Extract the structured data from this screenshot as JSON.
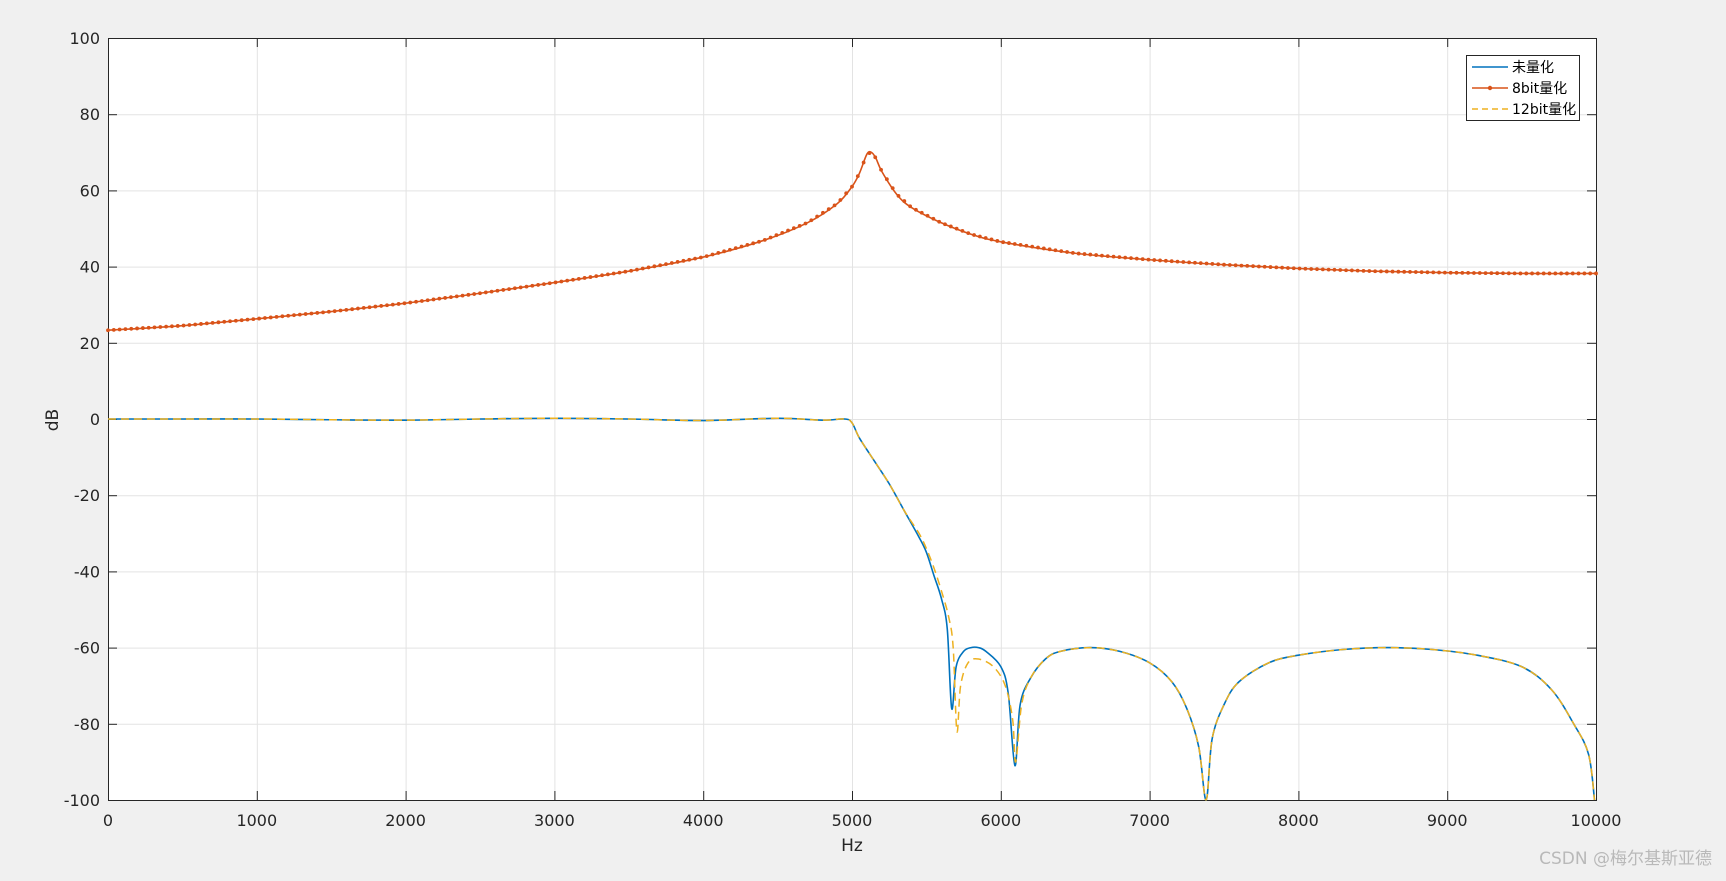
{
  "chart_data": {
    "type": "line",
    "title": "",
    "xlabel": "Hz",
    "ylabel": "dB",
    "xlim": [
      0,
      10000
    ],
    "ylim": [
      -100,
      100
    ],
    "xticks": [
      0,
      1000,
      2000,
      3000,
      4000,
      5000,
      6000,
      7000,
      8000,
      9000,
      10000
    ],
    "yticks": [
      -100,
      -80,
      -60,
      -40,
      -20,
      0,
      20,
      40,
      60,
      80,
      100
    ],
    "grid": true,
    "legend_position": "top-right",
    "series": [
      {
        "name": "未量化",
        "color": "#0072BD",
        "style": "solid",
        "points": [
          [
            0,
            0
          ],
          [
            500,
            0
          ],
          [
            1000,
            0
          ],
          [
            1500,
            -0.2
          ],
          [
            2000,
            -0.3
          ],
          [
            2500,
            0
          ],
          [
            3000,
            0.2
          ],
          [
            3500,
            0
          ],
          [
            4000,
            -0.4
          ],
          [
            4500,
            0.2
          ],
          [
            4800,
            -0.3
          ],
          [
            4950,
            0
          ],
          [
            5000,
            -1
          ],
          [
            5050,
            -5
          ],
          [
            5150,
            -11
          ],
          [
            5250,
            -17
          ],
          [
            5350,
            -24
          ],
          [
            5450,
            -31
          ],
          [
            5500,
            -35
          ],
          [
            5550,
            -41
          ],
          [
            5600,
            -47
          ],
          [
            5640,
            -55
          ],
          [
            5670,
            -76
          ],
          [
            5700,
            -65
          ],
          [
            5750,
            -61
          ],
          [
            5800,
            -60
          ],
          [
            5850,
            -60
          ],
          [
            5900,
            -61
          ],
          [
            6000,
            -65
          ],
          [
            6050,
            -72
          ],
          [
            6095,
            -91
          ],
          [
            6130,
            -75
          ],
          [
            6200,
            -68
          ],
          [
            6300,
            -63
          ],
          [
            6400,
            -61
          ],
          [
            6600,
            -60
          ],
          [
            6800,
            -61
          ],
          [
            7000,
            -64
          ],
          [
            7150,
            -69
          ],
          [
            7250,
            -76
          ],
          [
            7330,
            -86
          ],
          [
            7380,
            -100
          ],
          [
            7420,
            -84
          ],
          [
            7500,
            -75
          ],
          [
            7600,
            -69
          ],
          [
            7800,
            -64
          ],
          [
            8000,
            -62
          ],
          [
            8300,
            -60.5
          ],
          [
            8600,
            -60
          ],
          [
            8900,
            -60.5
          ],
          [
            9200,
            -62
          ],
          [
            9500,
            -65
          ],
          [
            9700,
            -71
          ],
          [
            9850,
            -80
          ],
          [
            9950,
            -88
          ],
          [
            9990,
            -100
          ]
        ]
      },
      {
        "name": "8bit量化",
        "color": "#D95319",
        "style": "solid-dot",
        "points": [
          [
            0,
            23.3
          ],
          [
            500,
            24.5
          ],
          [
            1000,
            26.3
          ],
          [
            1500,
            28.2
          ],
          [
            2000,
            30.4
          ],
          [
            2500,
            33
          ],
          [
            3000,
            35.8
          ],
          [
            3500,
            38.8
          ],
          [
            4000,
            42.5
          ],
          [
            4400,
            46.8
          ],
          [
            4700,
            51.5
          ],
          [
            4900,
            56.5
          ],
          [
            5000,
            61
          ],
          [
            5050,
            64.5
          ],
          [
            5100,
            69.5
          ],
          [
            5130,
            70
          ],
          [
            5160,
            68.5
          ],
          [
            5200,
            65
          ],
          [
            5300,
            59
          ],
          [
            5400,
            55.5
          ],
          [
            5600,
            51.5
          ],
          [
            5800,
            48.5
          ],
          [
            6000,
            46.5
          ],
          [
            6500,
            43.5
          ],
          [
            7000,
            41.8
          ],
          [
            7500,
            40.5
          ],
          [
            8000,
            39.5
          ],
          [
            8500,
            38.8
          ],
          [
            9000,
            38.4
          ],
          [
            9500,
            38.2
          ],
          [
            10000,
            38.2
          ]
        ]
      },
      {
        "name": "12bit量化",
        "color": "#EDB120",
        "style": "dashed",
        "points": [
          [
            0,
            0
          ],
          [
            500,
            0
          ],
          [
            1000,
            0
          ],
          [
            1500,
            -0.2
          ],
          [
            2000,
            -0.3
          ],
          [
            2500,
            0
          ],
          [
            3000,
            0.2
          ],
          [
            3500,
            0
          ],
          [
            4000,
            -0.4
          ],
          [
            4500,
            0.2
          ],
          [
            4800,
            -0.3
          ],
          [
            4950,
            0
          ],
          [
            5000,
            -1
          ],
          [
            5050,
            -5
          ],
          [
            5150,
            -11
          ],
          [
            5250,
            -17
          ],
          [
            5350,
            -24
          ],
          [
            5450,
            -30
          ],
          [
            5500,
            -34
          ],
          [
            5550,
            -39
          ],
          [
            5600,
            -45
          ],
          [
            5650,
            -52
          ],
          [
            5680,
            -60
          ],
          [
            5705,
            -82
          ],
          [
            5730,
            -70
          ],
          [
            5780,
            -64
          ],
          [
            5850,
            -63
          ],
          [
            5950,
            -65
          ],
          [
            6030,
            -70
          ],
          [
            6080,
            -79
          ],
          [
            6100,
            -90
          ],
          [
            6140,
            -75
          ],
          [
            6200,
            -68
          ],
          [
            6300,
            -63
          ],
          [
            6400,
            -61
          ],
          [
            6600,
            -60
          ],
          [
            6800,
            -61
          ],
          [
            7000,
            -64
          ],
          [
            7150,
            -69
          ],
          [
            7250,
            -76
          ],
          [
            7330,
            -86
          ],
          [
            7380,
            -100
          ],
          [
            7420,
            -84
          ],
          [
            7500,
            -75
          ],
          [
            7600,
            -69
          ],
          [
            7800,
            -64
          ],
          [
            8000,
            -62
          ],
          [
            8300,
            -60.5
          ],
          [
            8600,
            -60
          ],
          [
            8900,
            -60.5
          ],
          [
            9200,
            -62
          ],
          [
            9500,
            -65
          ],
          [
            9700,
            -71
          ],
          [
            9850,
            -80
          ],
          [
            9950,
            -88
          ],
          [
            9990,
            -100
          ]
        ]
      }
    ]
  },
  "watermark": "CSDN @梅尔基斯亚德"
}
